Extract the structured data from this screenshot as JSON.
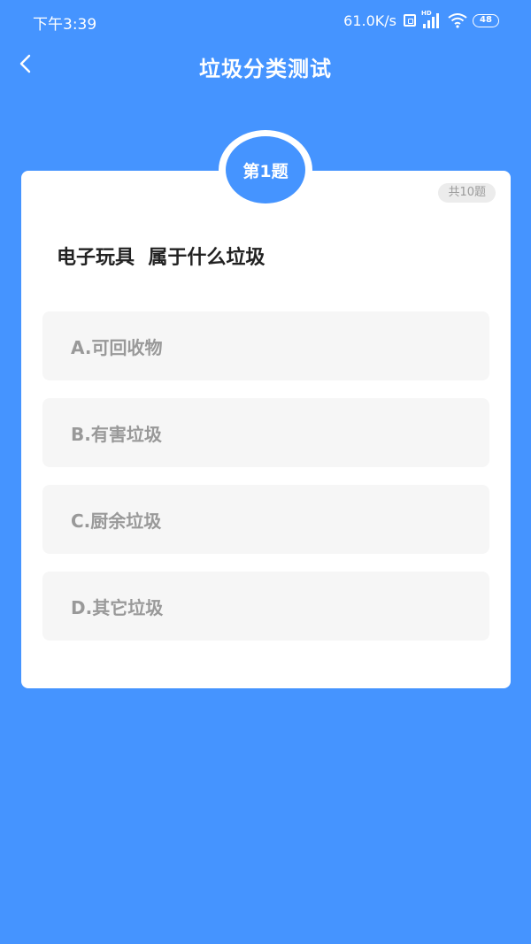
{
  "status_bar": {
    "time": "下午3:39",
    "net_speed": "61.0K/s",
    "signal_label": "HD",
    "battery": "48"
  },
  "nav": {
    "title": "垃圾分类测试"
  },
  "quiz": {
    "question_badge": "第1题",
    "total_label": "共10题",
    "question": "电子玩具  属于什么垃圾",
    "options": [
      "A.可回收物",
      "B.有害垃圾",
      "C.厨余垃圾",
      "D.其它垃圾"
    ]
  },
  "colors": {
    "primary": "#4594ff",
    "card": "#ffffff",
    "option_bg": "#f6f6f6",
    "option_text": "#999999"
  }
}
